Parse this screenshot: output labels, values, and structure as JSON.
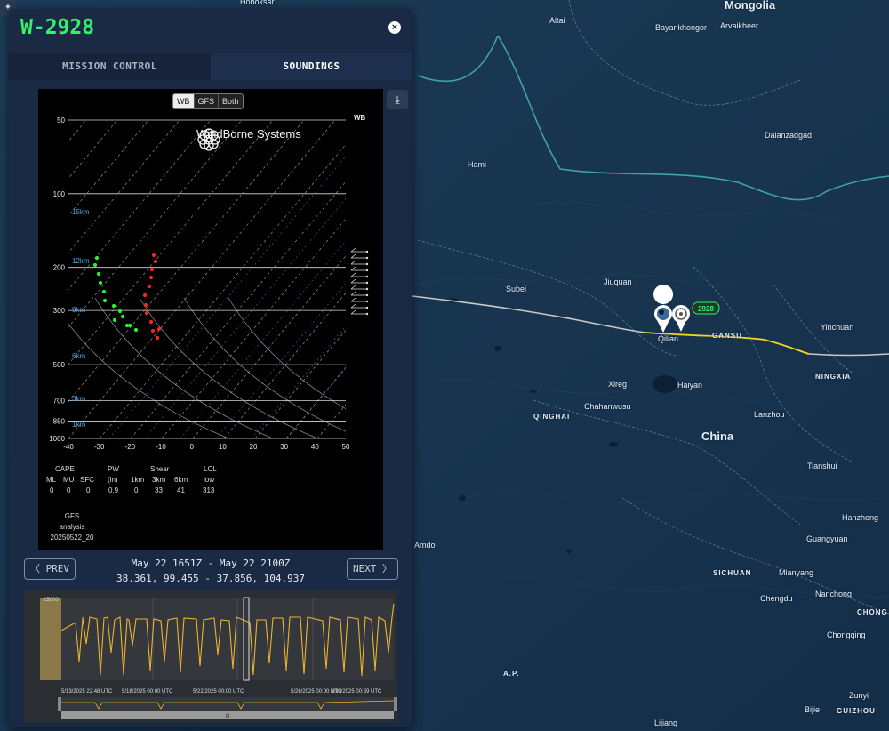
{
  "map": {
    "labels": [
      {
        "text": "Hoboksar",
        "cls": ""
      },
      {
        "text": "Mongolia",
        "cls": "country"
      },
      {
        "text": "Altai",
        "cls": ""
      },
      {
        "text": "Bayankhongor",
        "cls": ""
      },
      {
        "text": "Arvaikheer",
        "cls": ""
      },
      {
        "text": "Dalanzadgad",
        "cls": ""
      },
      {
        "text": "Hami",
        "cls": ""
      },
      {
        "text": "Subei",
        "cls": ""
      },
      {
        "text": "Jiuquan",
        "cls": ""
      },
      {
        "text": "Qilian",
        "cls": ""
      },
      {
        "text": "GANSU",
        "cls": "region"
      },
      {
        "text": "Yinchuan",
        "cls": ""
      },
      {
        "text": "NINGXIA",
        "cls": "region"
      },
      {
        "text": "Xireg",
        "cls": ""
      },
      {
        "text": "Haiyan",
        "cls": ""
      },
      {
        "text": "Chahanwusu",
        "cls": ""
      },
      {
        "text": "QINGHAI",
        "cls": "region"
      },
      {
        "text": "Lanzhou",
        "cls": ""
      },
      {
        "text": "China",
        "cls": "country"
      },
      {
        "text": "Tianshui",
        "cls": ""
      },
      {
        "text": "Hanzhong",
        "cls": ""
      },
      {
        "text": "Guangyuan",
        "cls": ""
      },
      {
        "text": "Amdo",
        "cls": ""
      },
      {
        "text": "SICHUAN",
        "cls": "region"
      },
      {
        "text": "Mianyang",
        "cls": ""
      },
      {
        "text": "Chengdu",
        "cls": ""
      },
      {
        "text": "Nanchong",
        "cls": ""
      },
      {
        "text": "CHONG",
        "cls": "region"
      },
      {
        "text": "Chongqing",
        "cls": ""
      },
      {
        "text": "A.P.",
        "cls": "region"
      },
      {
        "text": "Zunyi",
        "cls": ""
      },
      {
        "text": "Bijie",
        "cls": ""
      },
      {
        "text": "GUIZHOU",
        "cls": "region"
      },
      {
        "text": "Lijiang",
        "cls": ""
      }
    ],
    "balloon_badge": "2928"
  },
  "panel": {
    "title": "W-2928",
    "close": "×",
    "tabs": [
      {
        "label": "MISSION CONTROL",
        "active": false
      },
      {
        "label": "SOUNDINGS",
        "active": true
      }
    ],
    "download_icon": "⤓"
  },
  "skewt": {
    "source_buttons": [
      {
        "label": "WB",
        "active": true
      },
      {
        "label": "GFS",
        "active": false
      },
      {
        "label": "Both",
        "active": false
      }
    ],
    "corner_label": "WB",
    "brand": "WindBorne Systems",
    "pressure_levels": [
      50,
      100,
      200,
      300,
      500,
      700,
      850,
      1000
    ],
    "height_labels": [
      "15km",
      "12km",
      "9km",
      "6km",
      "3km",
      "1km"
    ],
    "temp_ticks": [
      -40,
      -30,
      -20,
      -10,
      0,
      10,
      20,
      30,
      40,
      50
    ]
  },
  "stats": {
    "headers": {
      "cape": "CAPE",
      "pw": "PW",
      "shear": "Shear",
      "lcl": "LCL"
    },
    "sub_headers": {
      "ml": "ML",
      "mu": "MU",
      "sfc": "SFC",
      "pw_unit": "(in)",
      "s1": "1km",
      "s3": "3km",
      "s6": "6km",
      "lcl_level": "low"
    },
    "values": {
      "ml": "0",
      "mu": "0",
      "sfc": "0",
      "pw": "0.9",
      "s1": "0",
      "s3": "33",
      "s6": "41",
      "lcl": "313"
    }
  },
  "gfs_info": {
    "line1": "GFS",
    "line2": "analysis",
    "line3": "20250522_20"
  },
  "nav": {
    "prev": "PREV",
    "next": "NEXT",
    "time_range": "May 22 1651Z - May 22 2100Z",
    "coords": "38.361, 99.455 - 37.856, 104.937"
  },
  "timeline": {
    "ymax_label": "15000",
    "date_labels": [
      "5/13/2025 22:48 UTC",
      "5/18/2025 00:00 UTC",
      "5/22/2025 00:00 UTC",
      "5/26/2025 00:00 UTC",
      "5/30/2025 00:59 UTC"
    ],
    "scroll_grip": "III"
  }
}
